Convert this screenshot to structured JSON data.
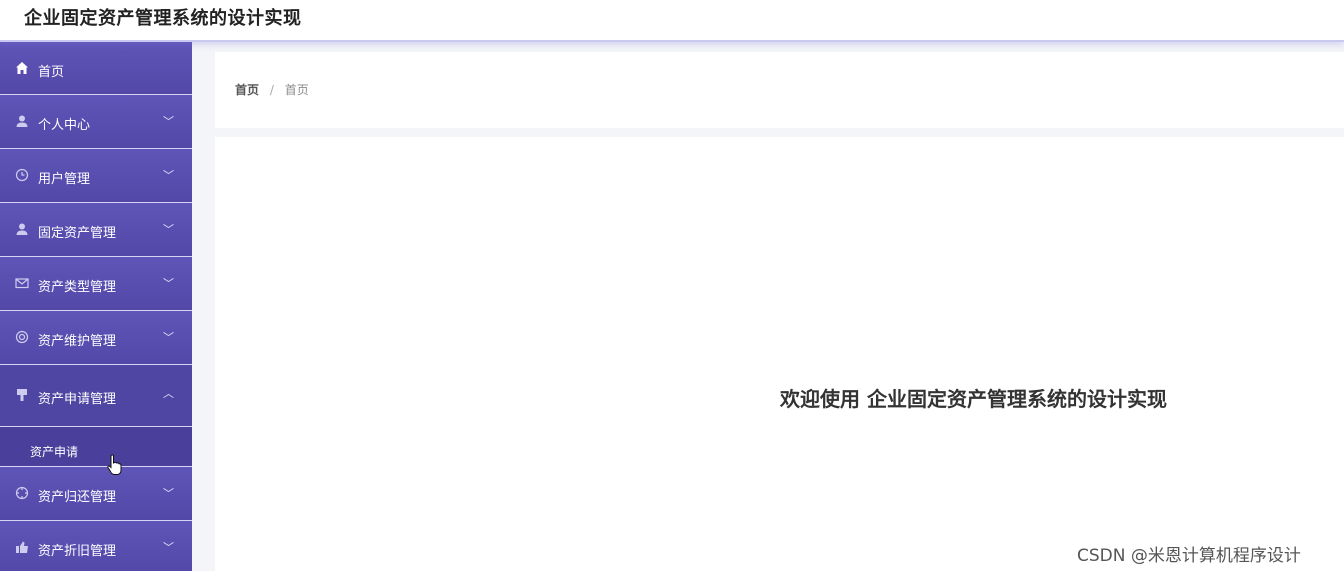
{
  "app": {
    "title": "企业固定资产管理系统的设计实现"
  },
  "sidebar": {
    "items": [
      {
        "label": "首页",
        "icon": "home-icon"
      },
      {
        "label": "个人中心",
        "icon": "user-icon"
      },
      {
        "label": "用户管理",
        "icon": "clock-icon"
      },
      {
        "label": "固定资产管理",
        "icon": "user-icon"
      },
      {
        "label": "资产类型管理",
        "icon": "mail-icon"
      },
      {
        "label": "资产维护管理",
        "icon": "lifebuoy-icon"
      },
      {
        "label": "资产申请管理",
        "icon": "brush-icon",
        "expanded": true,
        "children": [
          {
            "label": "资产申请"
          }
        ]
      },
      {
        "label": "资产归还管理",
        "icon": "target-icon"
      },
      {
        "label": "资产折旧管理",
        "icon": "thumb-icon"
      }
    ]
  },
  "breadcrumb": {
    "home": "首页",
    "separator": "/",
    "current": "首页"
  },
  "main": {
    "welcome": "欢迎使用 企业固定资产管理系统的设计实现"
  },
  "watermark": "CSDN @米恩计算机程序设计",
  "colors": {
    "sidebar": "#5a4fb0",
    "accent": "#c9c8f0"
  }
}
